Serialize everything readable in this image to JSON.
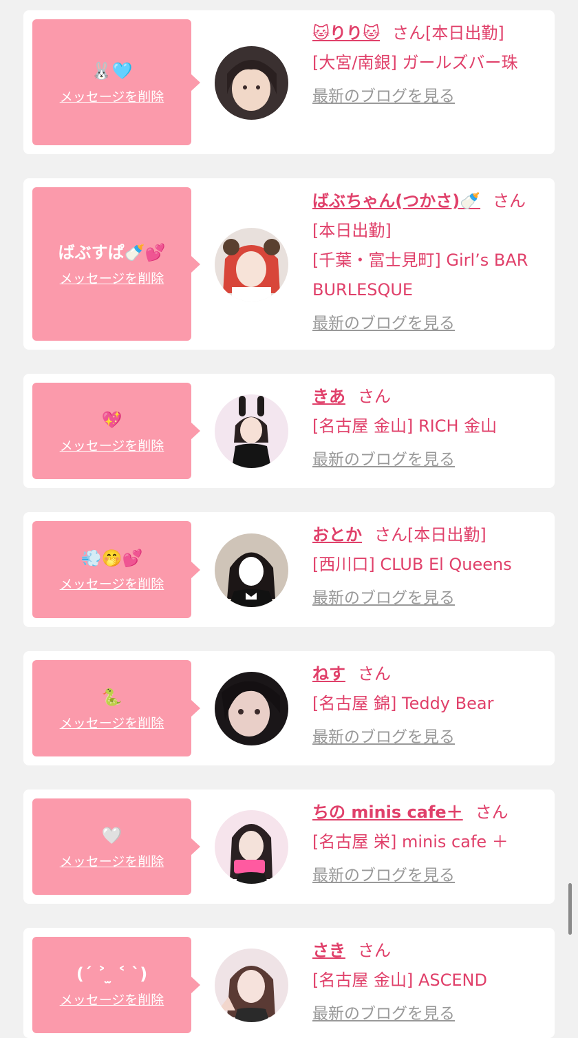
{
  "delete_label": "メッセージを削除",
  "blog_label": "最新のブログを見る",
  "honorific": "さん",
  "accent_color": "#e0406a",
  "bubble_color": "#fb9aab",
  "cards": [
    {
      "message": "🐰🩵",
      "name": "🐱りり🐱",
      "status": "[本日出勤]",
      "shop": "[大宮/南銀] ガールズバー珠",
      "avatar_icon": "girl-photo-avatar"
    },
    {
      "message": "ばぶすぱ🍼💕",
      "name": "ばぶちゃん(つかさ)🍼",
      "status": "[本日出勤]",
      "shop": "[千葉・富士見町] Girl’s BAR BURLESQUE",
      "avatar_icon": "girl-photo-avatar"
    },
    {
      "message": "💖",
      "name": "きあ",
      "status": "",
      "shop": "[名古屋 金山] RICH 金山",
      "avatar_icon": "girl-photo-avatar"
    },
    {
      "message": "💨🤭💕",
      "name": "おとか",
      "status": "[本日出勤]",
      "shop": "[西川口] CLUB El Queens",
      "avatar_icon": "girl-photo-avatar"
    },
    {
      "message": "🐍",
      "name": "ねす",
      "status": "",
      "shop": "[名古屋 錦] Teddy Bear",
      "avatar_icon": "girl-photo-avatar"
    },
    {
      "message": "🤍",
      "name": "ちの minis cafe＋",
      "status": "",
      "shop": "[名古屋 栄] minis cafe ＋",
      "avatar_icon": "girl-photo-avatar"
    },
    {
      "message": "(ˊ ˃ ̫ ˂ ˋ)",
      "name": "さき",
      "status": "",
      "shop": "[名古屋 金山] ASCEND",
      "avatar_icon": "girl-photo-avatar"
    }
  ]
}
